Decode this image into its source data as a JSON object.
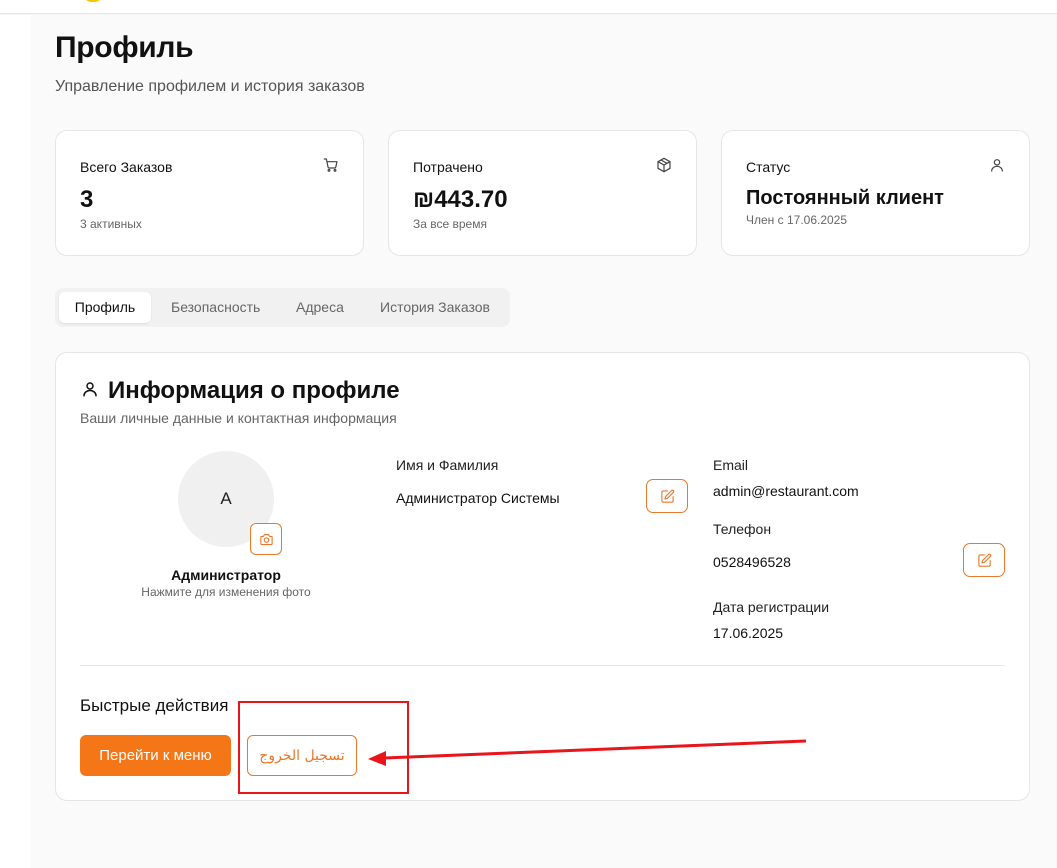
{
  "page": {
    "title": "Профиль",
    "subtitle": "Управление профилем и история заказов"
  },
  "stats": [
    {
      "label": "Всего Заказов",
      "value": "3",
      "note": "3 активных",
      "icon": "cart-icon"
    },
    {
      "label": "Потрачено",
      "value": "₪443.70",
      "note": "За все время",
      "icon": "package-icon"
    },
    {
      "label": "Статус",
      "value": "Постоянный клиент",
      "note": "Член с 17.06.2025",
      "icon": "user-icon"
    }
  ],
  "tabs": [
    {
      "label": "Профиль",
      "active": true
    },
    {
      "label": "Безопасность",
      "active": false
    },
    {
      "label": "Адреса",
      "active": false
    },
    {
      "label": "История Заказов",
      "active": false
    }
  ],
  "profile": {
    "title": "Информация о профиле",
    "subtitle": "Ваши личные данные и контактная информация",
    "avatar_letter": "A",
    "avatar_name": "Администратор",
    "avatar_hint": "Нажмите для изменения фото",
    "name_label": "Имя и Фамилия",
    "name_value": "Администратор Системы",
    "email_label": "Email",
    "email_value": "admin@restaurant.com",
    "phone_label": "Телефон",
    "phone_value": "0528496528",
    "reg_label": "Дата регистрации",
    "reg_value": "17.06.2025"
  },
  "quick_actions": {
    "title": "Быстрые действия",
    "menu_button": "Перейти к меню",
    "logout_button": "تسجيل الخروج"
  },
  "colors": {
    "accent": "#f57617",
    "annotation": "#e8151b"
  }
}
